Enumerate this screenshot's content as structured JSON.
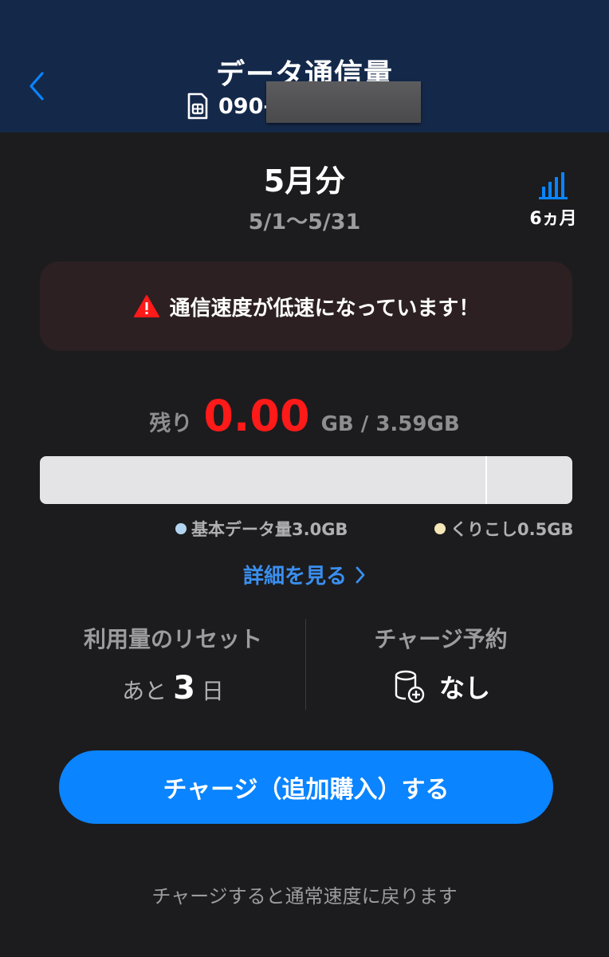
{
  "header": {
    "title": "データ通信量",
    "phone_prefix": "090-",
    "back_icon": "chevron-left-icon",
    "sim_icon": "sim-card-icon"
  },
  "period": {
    "month": "5月分",
    "range": "5/1〜5/31"
  },
  "history": {
    "icon": "bar-chart-icon",
    "label": "6ヵ月"
  },
  "alert": {
    "icon": "warning-icon",
    "message": "通信速度が低速になっています！"
  },
  "usage": {
    "remaining_label": "残り",
    "remaining_value": "0.00",
    "total_text": "GB / 3.59GB",
    "remaining_fraction": 0.0,
    "legend": [
      {
        "label": "基本データ量3.0GB",
        "color": "#b3d4f0"
      },
      {
        "label": "くりこし0.5GB",
        "color": "#f5e6b8"
      }
    ]
  },
  "details": {
    "label": "詳細を見る"
  },
  "reset": {
    "title": "利用量のリセット",
    "prefix": "あと",
    "days": "3",
    "suffix": "日"
  },
  "reservation": {
    "title": "チャージ予約",
    "icon": "data-add-icon",
    "value": "なし"
  },
  "charge_button": {
    "label": "チャージ（追加購入）する"
  },
  "footnote": "チャージすると通常速度に戻ります",
  "colors": {
    "header_bg": "#14294a",
    "page_bg": "#1c1c1e",
    "accent_blue": "#0a84ff",
    "alert_red": "#ff1a1a",
    "link_blue": "#3a8ff0"
  }
}
